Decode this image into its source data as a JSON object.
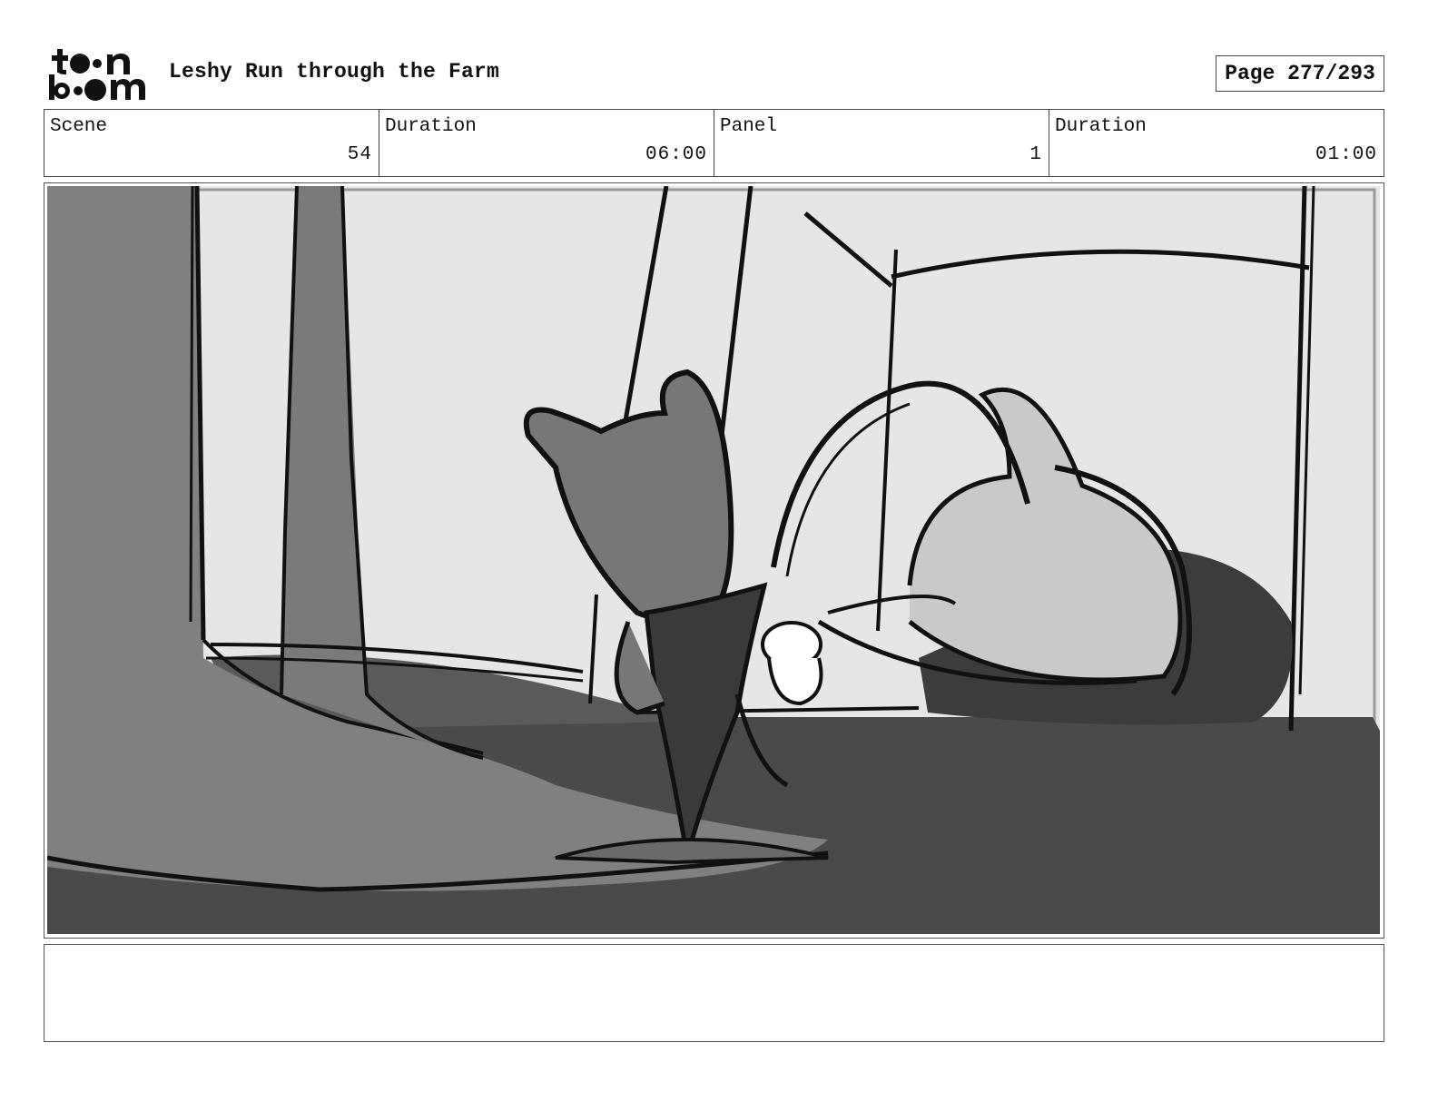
{
  "header": {
    "logo_text": "toon boom",
    "title": "Leshy Run through the Farm",
    "page": "Page 277/293"
  },
  "info": {
    "scene_label": "Scene",
    "scene_value": "54",
    "scene_duration_label": "Duration",
    "scene_duration_value": "06:00",
    "panel_label": "Panel",
    "panel_value": "1",
    "panel_duration_label": "Duration",
    "panel_duration_value": "01:00"
  },
  "notes": {
    "text": ""
  }
}
